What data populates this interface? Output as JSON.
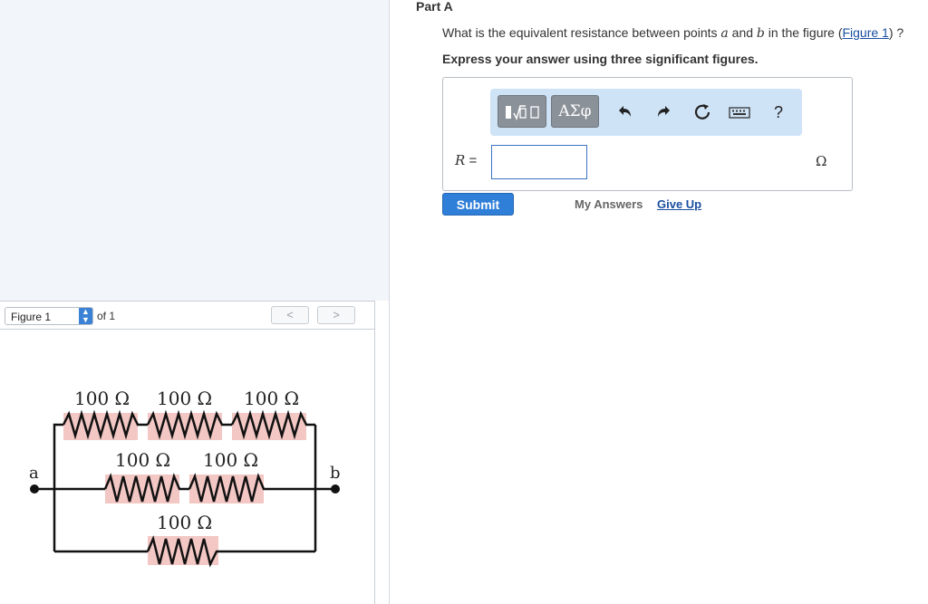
{
  "part": {
    "title": "Part A"
  },
  "question": {
    "prefix": "What is the equivalent resistance between points ",
    "var_a": "a",
    "mid": " and ",
    "var_b": "b",
    "suffix": " in the figure (",
    "link": "Figure 1",
    "end": ") ?"
  },
  "instruction": "Express your answer using three significant figures.",
  "toolbar": {
    "template_icon": "fraction-sqrt-template-icon",
    "greek_label": "ΑΣφ",
    "undo_icon": "undo-icon",
    "redo_icon": "redo-icon",
    "reset_icon": "reset-icon",
    "keyboard_icon": "keyboard-icon",
    "help_label": "?"
  },
  "answer": {
    "label_var": "R",
    "label_eq": " =",
    "value": "",
    "unit": "Ω"
  },
  "actions": {
    "submit": "Submit",
    "my_answers": "My Answers",
    "give_up": "Give Up"
  },
  "figure": {
    "select_label": "Figure 1",
    "of_label": "of 1",
    "prev": "<",
    "next": ">",
    "point_a": "a",
    "point_b": "b",
    "resistors": [
      "100 Ω",
      "100 Ω",
      "100 Ω",
      "100 Ω",
      "100 Ω",
      "100 Ω"
    ]
  },
  "colors": {
    "accent": "#2f7ed8",
    "link": "#1a4fa0",
    "resistor_highlight": "#f2c7c4"
  }
}
